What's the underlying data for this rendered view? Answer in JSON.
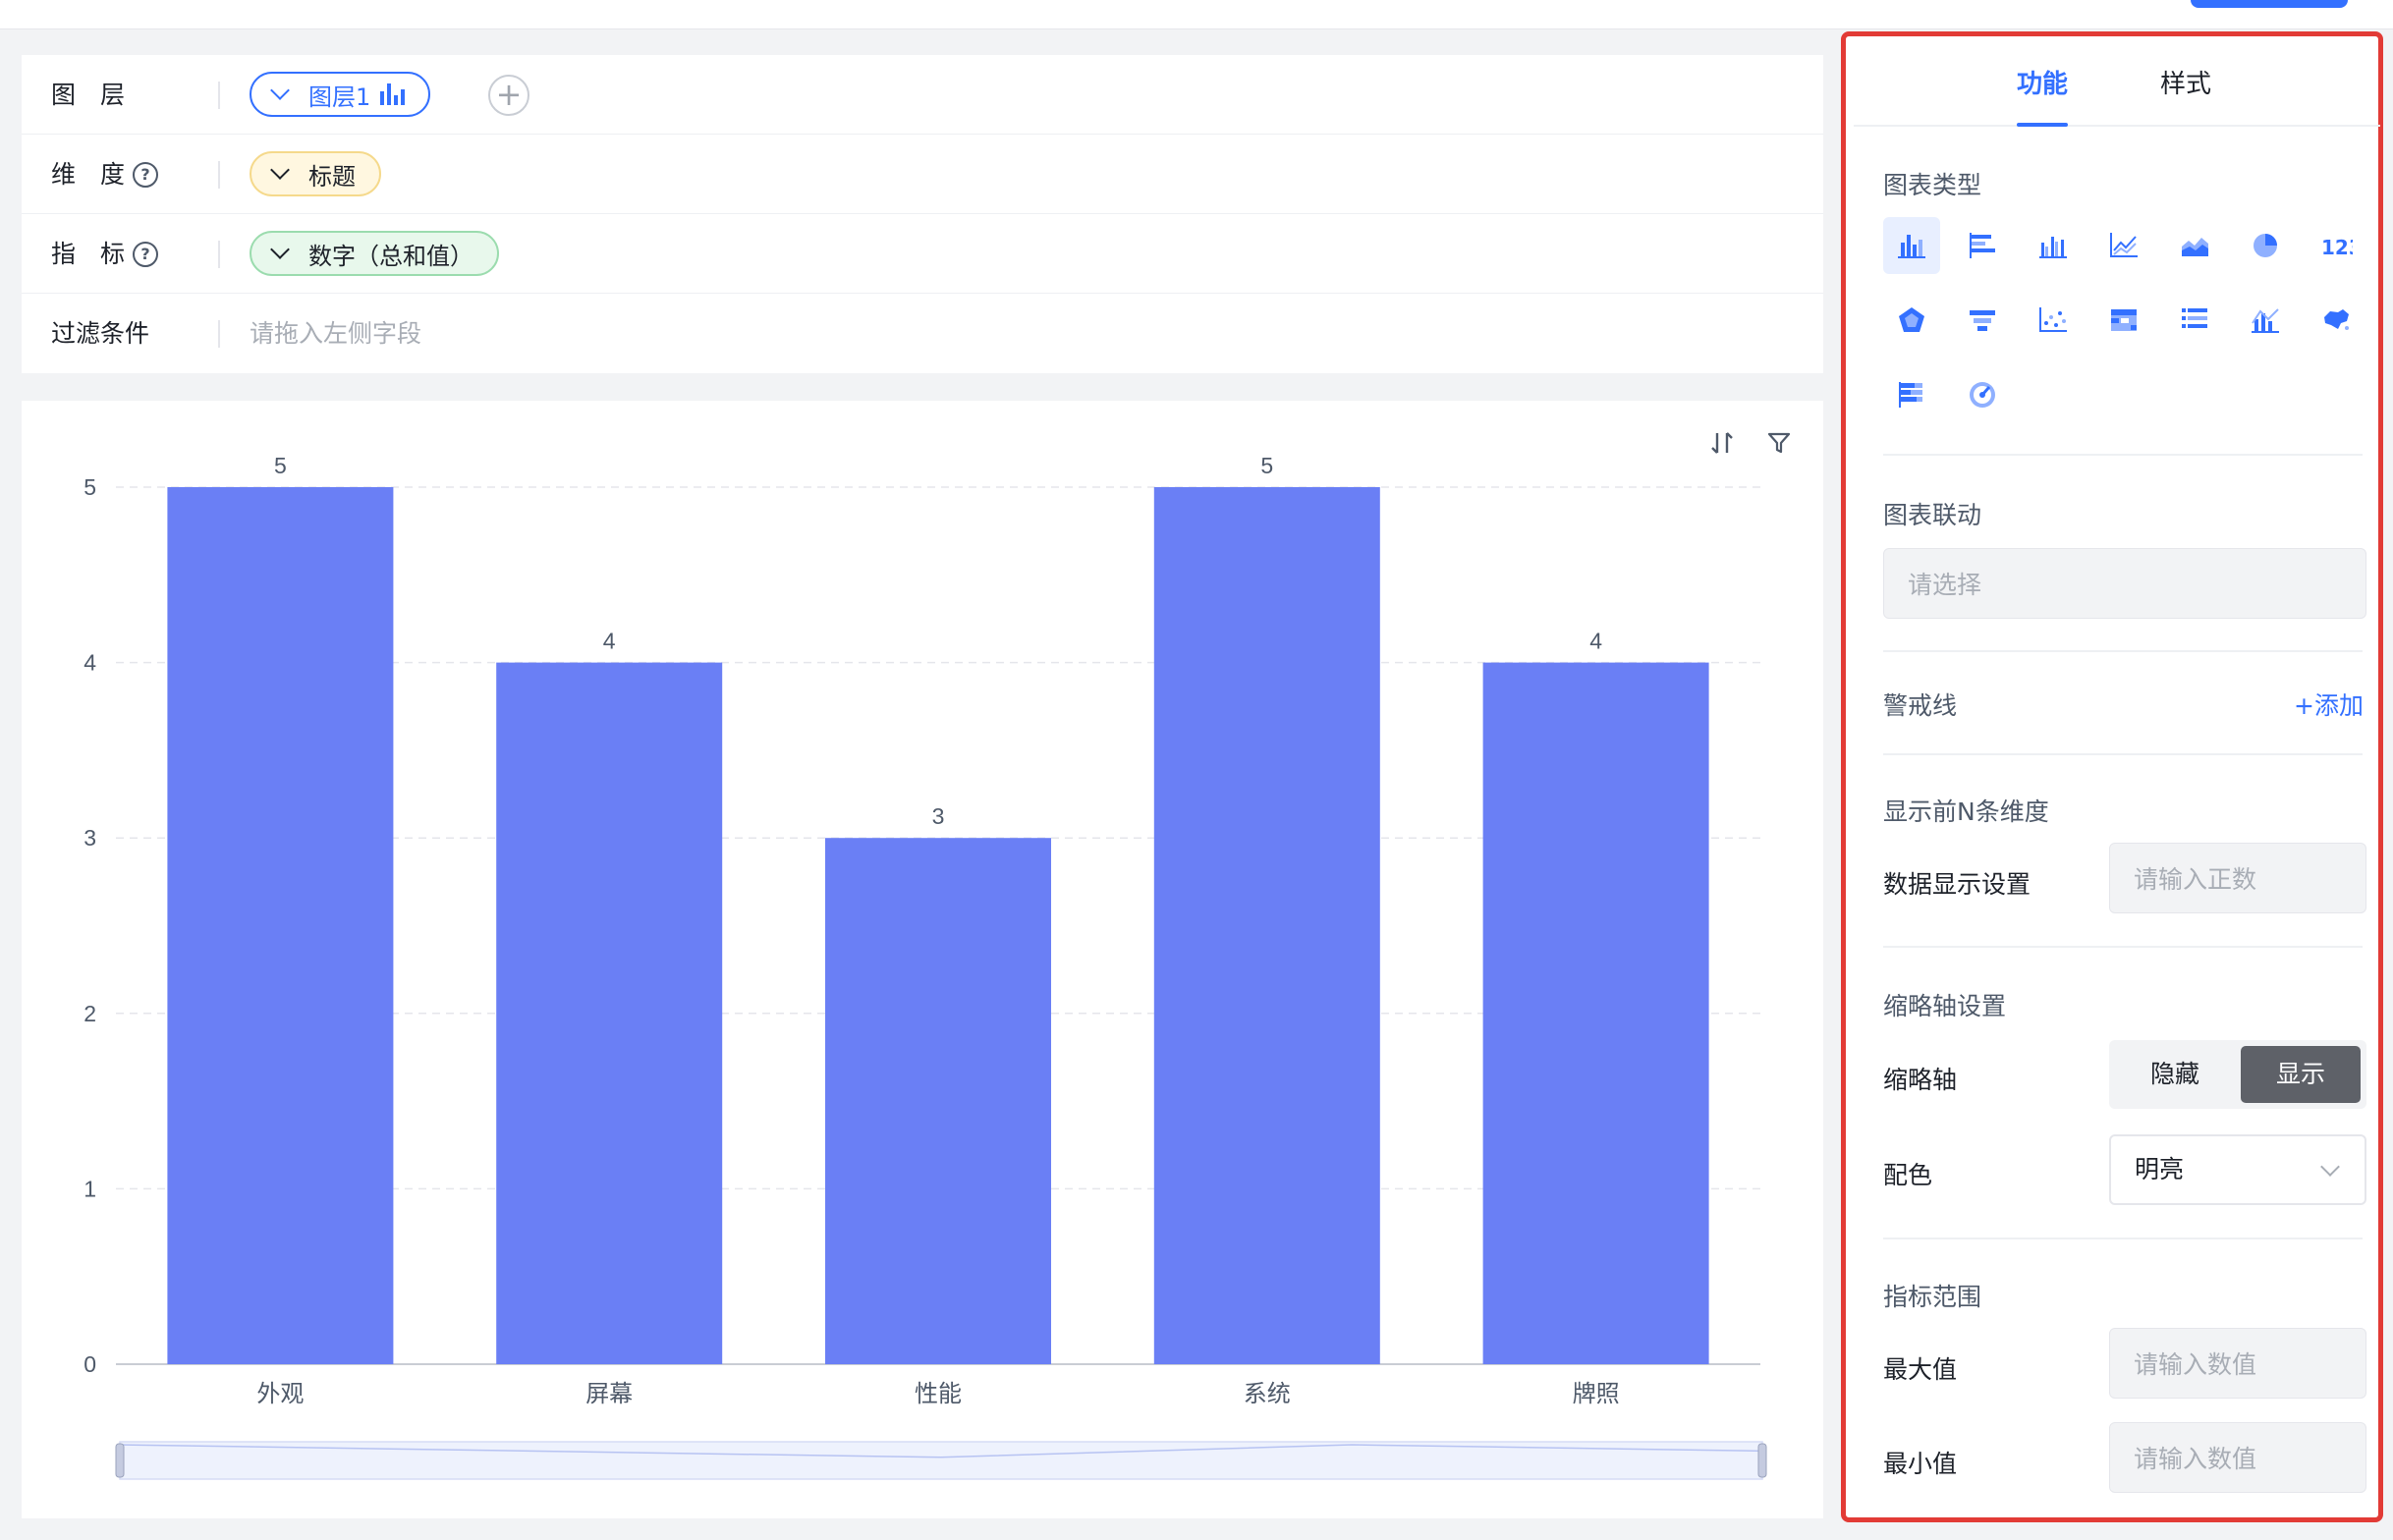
{
  "config": {
    "rows": [
      {
        "label": "图　层",
        "pill": "图层1"
      },
      {
        "label": "维　度",
        "pill": "标题"
      },
      {
        "label": "指　标",
        "pill": "数字（总和值）"
      },
      {
        "label": "过滤条件",
        "placeholder": "请拖入左侧字段"
      }
    ],
    "add_symbol": "+"
  },
  "chart_data": {
    "type": "bar",
    "categories": [
      "外观",
      "屏幕",
      "性能",
      "系统",
      "牌照"
    ],
    "values": [
      5,
      4,
      3,
      5,
      4
    ],
    "ylim": [
      0,
      5
    ],
    "yticks": [
      0,
      1,
      2,
      3,
      4,
      5
    ],
    "grid": true,
    "data_labels": true,
    "bar_color": "#6a7ff5",
    "datazoom": true
  },
  "chart_tools": {
    "sort_icon": "sort-icon",
    "filter_icon": "filter-icon"
  },
  "side": {
    "tabs": [
      "功能",
      "样式"
    ],
    "active_tab": 0,
    "chart_type_title": "图表类型",
    "chart_types": [
      "bar",
      "horizontal-bar",
      "grouped-bar",
      "line",
      "area",
      "pie",
      "number",
      "radar",
      "funnel",
      "scatter",
      "table",
      "list",
      "combo",
      "map",
      "stacked-horizontal-bar",
      "gauge"
    ],
    "selected_chart_type": "bar",
    "linkage_title": "图表联动",
    "linkage_placeholder": "请选择",
    "alert_title": "警戒线",
    "alert_add": "+添加",
    "topn_title": "显示前N条维度",
    "data_display_label": "数据显示设置",
    "data_display_placeholder": "请输入正数",
    "thumb_title": "缩略轴设置",
    "thumb_label": "缩略轴",
    "thumb_options": [
      "隐藏",
      "显示"
    ],
    "thumb_selected": 1,
    "color_label": "配色",
    "color_value": "明亮",
    "range_title": "指标范围",
    "max_label": "最大值",
    "max_placeholder": "请输入数值",
    "min_label": "最小值",
    "min_placeholder": "请输入数值"
  },
  "colors": {
    "accent": "#3370ff",
    "highlight_border": "#e23b36"
  }
}
